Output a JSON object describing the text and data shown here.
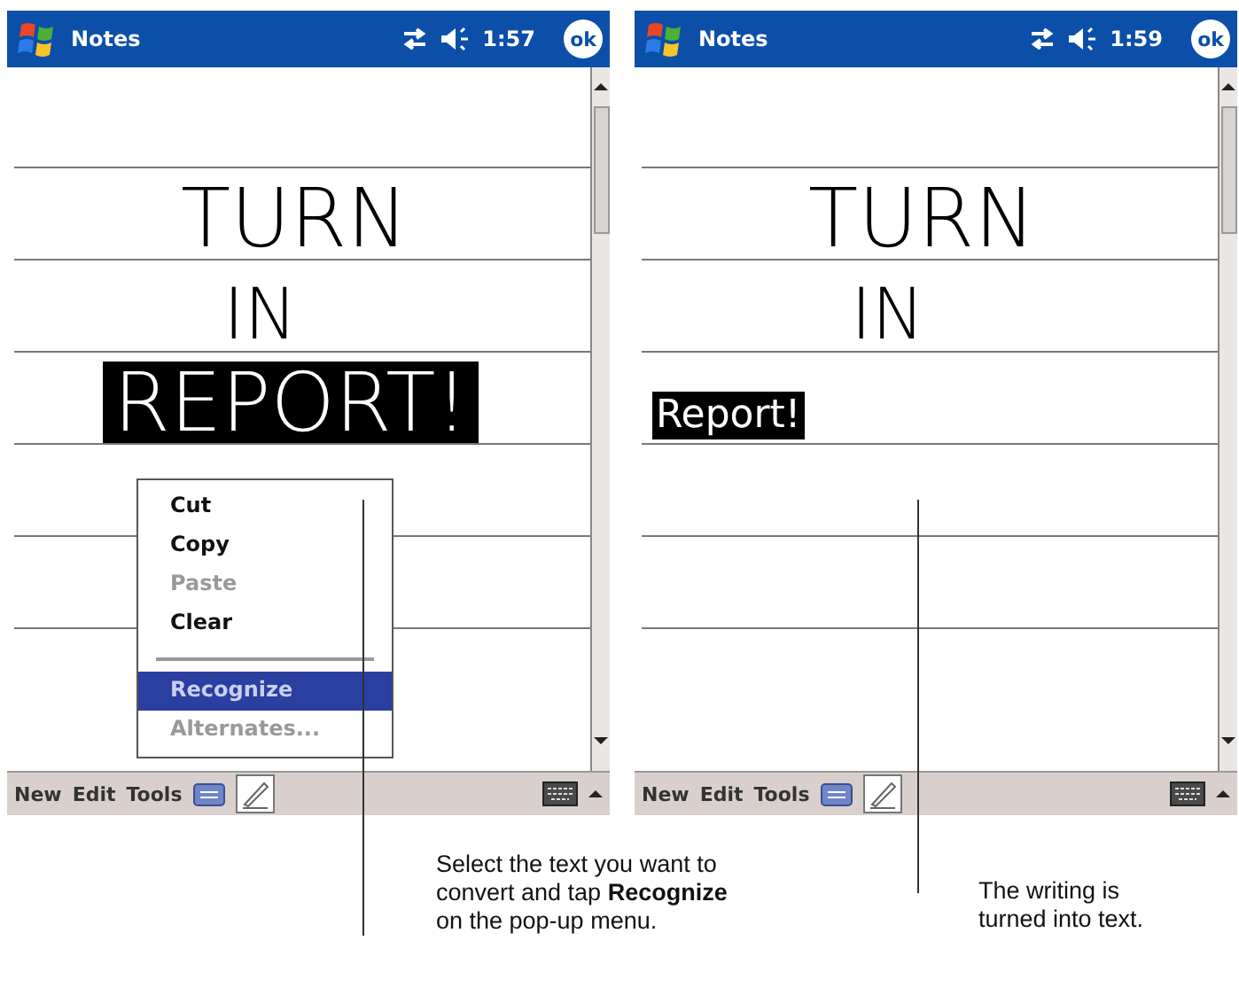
{
  "screens": [
    {
      "title": "Notes",
      "time": "1:57",
      "ok_label": "ok",
      "notes": [
        {
          "kind": "ink",
          "text": "TURN",
          "selected": false
        },
        {
          "kind": "ink",
          "text": "IN",
          "selected": false
        },
        {
          "kind": "ink",
          "text": "REPORT!",
          "selected": true
        }
      ],
      "menu": [
        {
          "kind": "item",
          "label": "Cut",
          "disabled": false,
          "selected": false
        },
        {
          "kind": "item",
          "label": "Copy",
          "disabled": false,
          "selected": false
        },
        {
          "kind": "item",
          "label": "Paste",
          "disabled": true,
          "selected": false
        },
        {
          "kind": "item",
          "label": "Clear",
          "disabled": false,
          "selected": false
        },
        {
          "kind": "separator"
        },
        {
          "kind": "item",
          "label": "Recognize",
          "disabled": false,
          "selected": true
        },
        {
          "kind": "item",
          "label": "Alternates...",
          "disabled": true,
          "selected": false
        }
      ],
      "toolbar": [
        "New",
        "Edit",
        "Tools"
      ]
    },
    {
      "title": "Notes",
      "time": "1:59",
      "ok_label": "ok",
      "notes": [
        {
          "kind": "ink",
          "text": "TURN",
          "selected": false
        },
        {
          "kind": "ink",
          "text": "IN",
          "selected": false
        },
        {
          "kind": "text",
          "text": "Report!",
          "selected": true
        }
      ],
      "toolbar": [
        "New",
        "Edit",
        "Tools"
      ]
    }
  ],
  "callouts": [
    {
      "text": "Select the text you want to convert and tap **Recognize** on the pop-up menu."
    },
    {
      "text": "The writing is turned into text."
    }
  ]
}
